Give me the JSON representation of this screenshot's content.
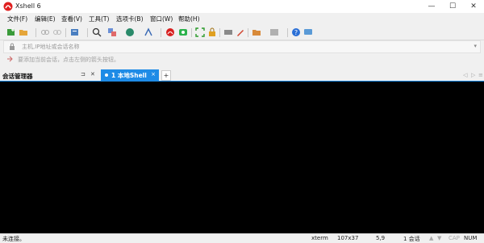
{
  "app": {
    "title": "Xshell 6",
    "brand_color": "#e02020",
    "accent": "#1e8be6"
  },
  "window": {
    "minimize": "—",
    "maximize": "☐",
    "close": "✕"
  },
  "menu": [
    "文件(F)",
    "编辑(E)",
    "查看(V)",
    "工具(T)",
    "选项卡(B)",
    "窗口(W)",
    "帮助(H)"
  ],
  "toolbar": {
    "icons": [
      "new-session-icon",
      "open-folder-icon",
      "link-icon",
      "unlink-icon",
      "properties-icon",
      "search-icon",
      "transfer-icon",
      "globe-icon",
      "font-icon",
      "red-session-icon",
      "green-session-icon",
      "fullscreen-icon",
      "lock-icon",
      "keyboard-icon",
      "highlight-icon",
      "script-icon",
      "layout-icon",
      "help-icon",
      "chat-icon"
    ]
  },
  "address": {
    "placeholder": "主机,IP地址或会话名称",
    "arrow": "▾"
  },
  "hint": {
    "text": "要添加当前会话，点击左侧的箭头按钮。"
  },
  "session_panel": {
    "title": "会话管理器",
    "pin": "⊐",
    "close": "✕"
  },
  "tabs": [
    {
      "label": "1 本地Shell",
      "close": "×"
    }
  ],
  "tab_add": "+",
  "tab_nav": {
    "prev": "◁",
    "next": "▷",
    "menu": "≡"
  },
  "status": {
    "left": "未连接。",
    "term": "xterm",
    "size": "107x37",
    "pos": "5,9",
    "sessions": "1 会话",
    "up": "▲",
    "down": "▼",
    "cap": "CAP",
    "num": "NUM"
  }
}
